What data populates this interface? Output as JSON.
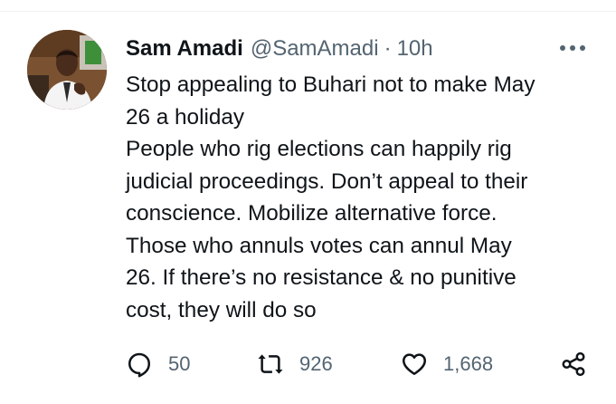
{
  "tweet": {
    "author": {
      "display_name": "Sam Amadi",
      "handle": "@SamAmadi",
      "separator": "·",
      "time": "10h"
    },
    "text_lines": [
      "Stop appealing to Buhari not to make May",
      "26 a holiday",
      "People who rig elections can happily rig",
      "judicial proceedings. Don’t appeal to their",
      "conscience. Mobilize alternative force.",
      "Those who annuls votes can annul May",
      "26. If there’s no resistance & no punitive",
      "cost, they will do so"
    ],
    "actions": {
      "replies": "50",
      "retweets": "926",
      "likes": "1,668"
    },
    "icons": {
      "more": "more-options-icon",
      "reply": "reply-icon",
      "retweet": "retweet-icon",
      "like": "heart-icon",
      "share": "share-icon"
    },
    "colors": {
      "text": "#0f1419",
      "secondary": "#536471",
      "divider": "#eff3f4"
    }
  }
}
